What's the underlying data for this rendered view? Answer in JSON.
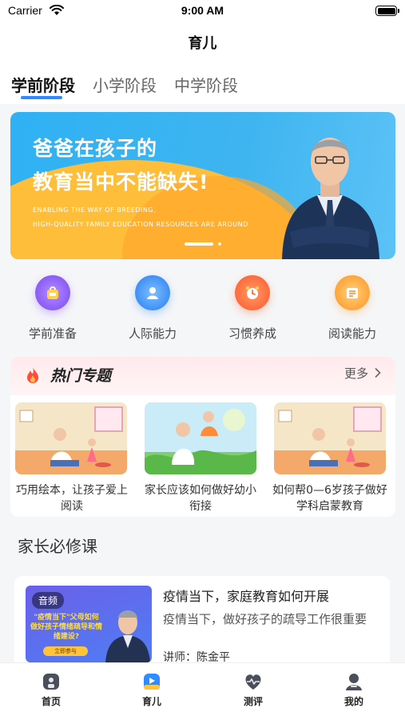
{
  "status_bar": {
    "carrier": "Carrier",
    "time": "9:00 AM"
  },
  "nav": {
    "title": "育儿"
  },
  "stage_tabs": [
    {
      "label": "学前阶段",
      "active": true
    },
    {
      "label": "小学阶段",
      "active": false
    },
    {
      "label": "中学阶段",
      "active": false
    }
  ],
  "banner": {
    "line1": "爸爸在孩子的",
    "line2": "教育当中不能缺失!",
    "sub1": "ENABLING THE WAY OF BREEDING,",
    "sub2": "HIGH-QUALITY FAMILY EDUCATION RESOURCES ARE AROUND"
  },
  "categories": [
    {
      "label": "学前准备",
      "icon": "schoolbag-icon",
      "color": "#8a5cf5"
    },
    {
      "label": "人际能力",
      "icon": "person-icon",
      "color": "#3f8ff5"
    },
    {
      "label": "习惯养成",
      "icon": "alarm-clock-icon",
      "color": "#ff6a3a"
    },
    {
      "label": "阅读能力",
      "icon": "book-icon",
      "color": "#ffa43a"
    }
  ],
  "hot": {
    "title": "热门专题",
    "more": "更多",
    "items": [
      {
        "caption": "巧用绘本，让孩子爱上阅读"
      },
      {
        "caption": "家长应该如何做好幼小衔接"
      },
      {
        "caption": "如何帮0—6岁孩子做好学科启蒙教育"
      }
    ]
  },
  "courses_section": {
    "title": "家长必修课"
  },
  "course": {
    "badge": "音频",
    "thumb_text": "\"疫情当下\"父母如何做好孩子情绪疏导和情绪建设?",
    "thumb_button": "立即参与",
    "title": "疫情当下，家庭教育如何开展",
    "desc": "疫情当下，做好孩子的疏导工作很重要",
    "teacher": "讲师：陈金平"
  },
  "tabbar": [
    {
      "label": "首页",
      "icon": "home-icon",
      "active": false
    },
    {
      "label": "育儿",
      "icon": "video-play-icon",
      "active": true
    },
    {
      "label": "测评",
      "icon": "heart-pulse-icon",
      "active": false
    },
    {
      "label": "我的",
      "icon": "user-profile-icon",
      "active": false
    }
  ],
  "colors": {
    "accent": "#2f8bff",
    "banner_blue": "#2fb1f4",
    "banner_orange": "#ffbe3a"
  }
}
